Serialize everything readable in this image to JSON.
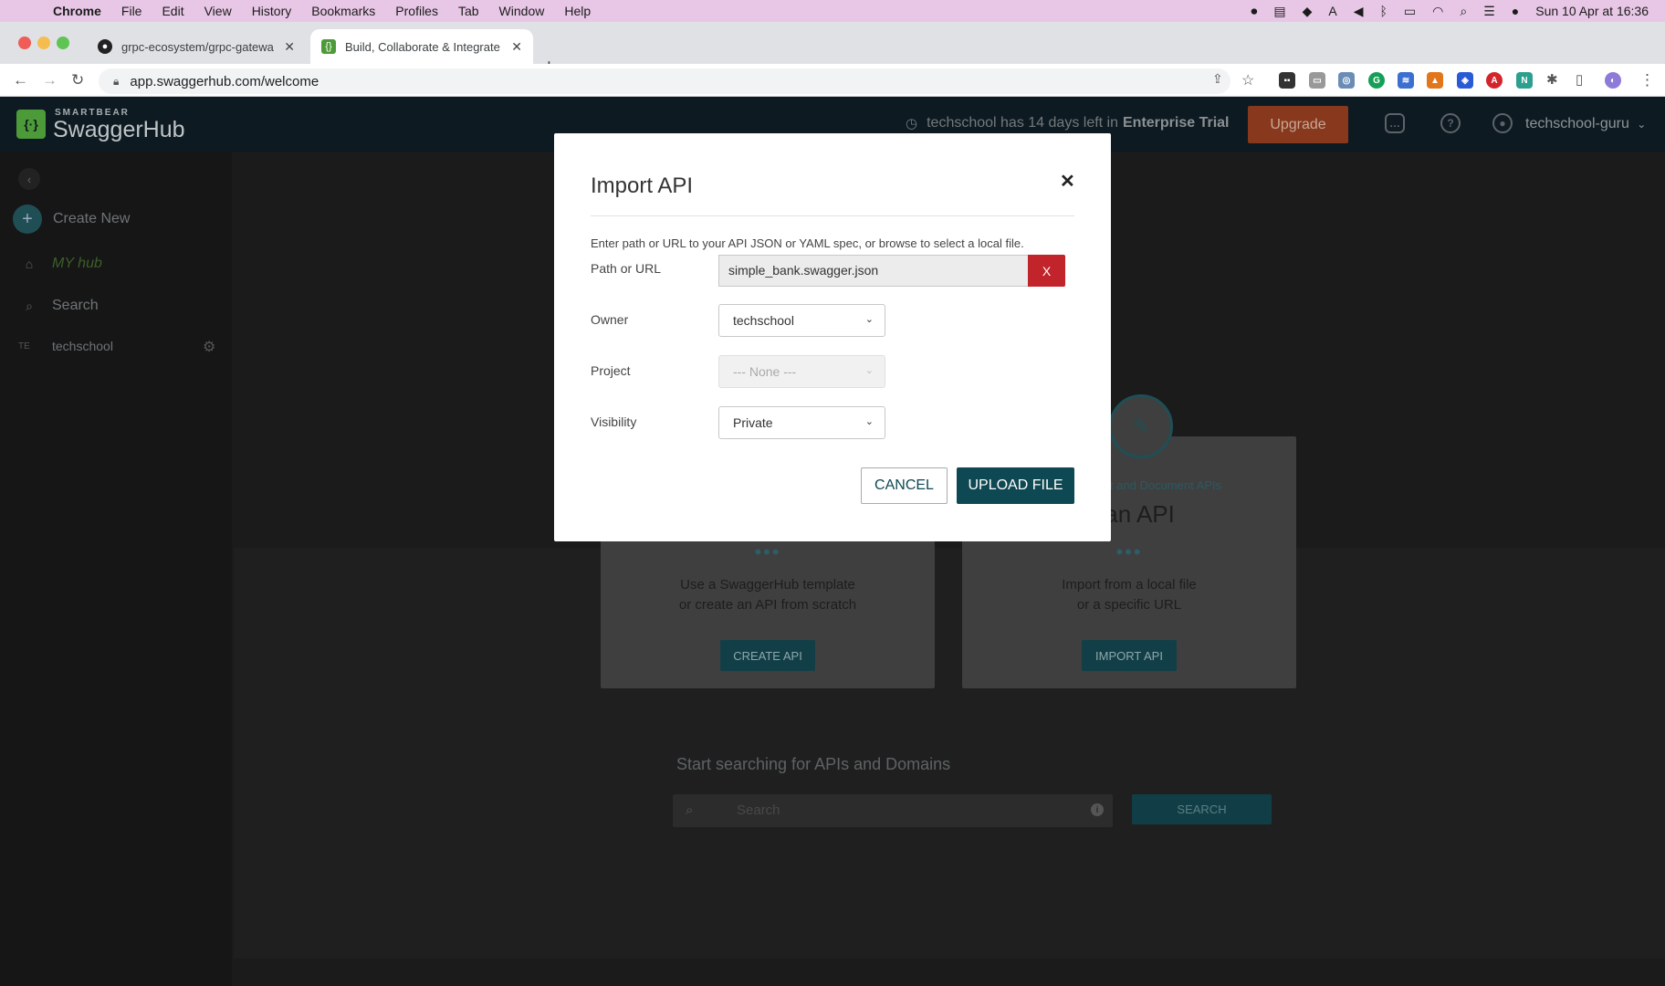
{
  "menubar": {
    "app": "Chrome",
    "items": [
      "File",
      "Edit",
      "View",
      "History",
      "Bookmarks",
      "Profiles",
      "Tab",
      "Window",
      "Help"
    ],
    "clock": "Sun 10 Apr at 16:36"
  },
  "tabs": [
    {
      "title": "grpc-ecosystem/grpc-gatewa",
      "icon": "github-icon"
    },
    {
      "title": "Build, Collaborate & Integrate /",
      "icon": "swaggerhub-icon"
    }
  ],
  "address": {
    "url": "app.swaggerhub.com/welcome"
  },
  "header": {
    "brand_small": "SMARTBEAR",
    "brand": "SwaggerHub",
    "trial_text": "techschool has 14 days left in",
    "trial_plan": "Enterprise Trial",
    "upgrade": "Upgrade",
    "user": "techschool-guru"
  },
  "sidebar": {
    "create_new": "Create New",
    "my": "MY",
    "hub": "hub",
    "search": "Search",
    "org_abbr": "TE",
    "org": "techschool"
  },
  "cards": {
    "create": {
      "desc1": "Use a SwaggerHub template",
      "desc2": "or create an API from scratch",
      "button": "CREATE API"
    },
    "import": {
      "subtitle": "t and Document APIs",
      "title": "rt an API",
      "desc1": "Import from a local file",
      "desc2": "or a specific URL",
      "button": "IMPORT API"
    }
  },
  "search": {
    "title": "Start searching for APIs and Domains",
    "placeholder": "Search",
    "button": "SEARCH"
  },
  "modal": {
    "title": "Import API",
    "help": "Enter path or URL to your API JSON or YAML spec, or browse to select a local file.",
    "path_label": "Path or URL",
    "path_value": "simple_bank.swagger.json",
    "clear": "X",
    "owner_label": "Owner",
    "owner_value": "techschool",
    "project_label": "Project",
    "project_value": "--- None ---",
    "visibility_label": "Visibility",
    "visibility_value": "Private",
    "cancel": "CANCEL",
    "upload": "UPLOAD FILE"
  }
}
